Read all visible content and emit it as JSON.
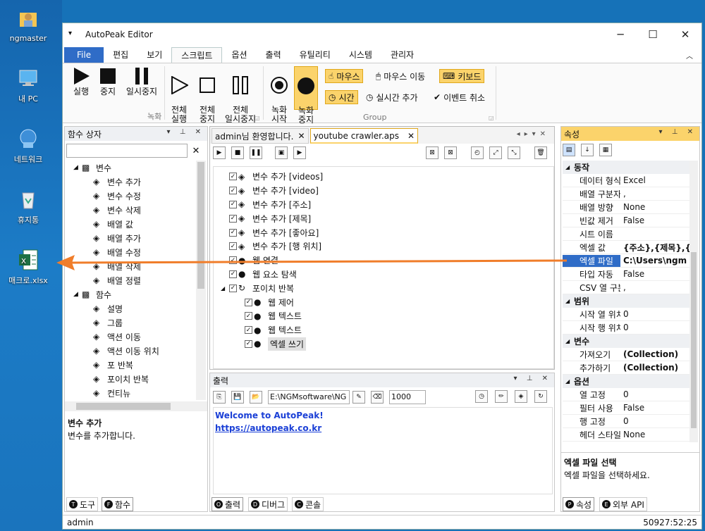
{
  "desktop": {
    "icons": [
      {
        "label": "ngmaster"
      },
      {
        "label": "내 PC"
      },
      {
        "label": "네트워크"
      },
      {
        "label": "휴지통"
      },
      {
        "label": "매크로.xlsx"
      }
    ]
  },
  "window": {
    "title": "AutoPeak Editor"
  },
  "menu": [
    "File",
    "편집",
    "보기",
    "스크립트",
    "옵션",
    "출력",
    "유틸리티",
    "시스템",
    "관리자"
  ],
  "ribbon": {
    "buttons": [
      {
        "label": "실행"
      },
      {
        "label": "중지"
      },
      {
        "label": "일시중지"
      },
      {
        "label": "전체\n실행"
      },
      {
        "label": "전체\n중지"
      },
      {
        "label": "전체\n일시중지"
      },
      {
        "label": "녹화\n시작"
      },
      {
        "label": "녹화\n중지"
      }
    ],
    "group1": "녹화",
    "group2": "Group",
    "chips": {
      "mouse": "마우스",
      "mouse_move": "마우스 이동",
      "keyboard": "키보드",
      "time": "시간",
      "realtime": "실시간 추가",
      "event_cancel": "이벤트 취소"
    }
  },
  "toolbox": {
    "title": "함수 상자",
    "items": [
      {
        "label": "변수",
        "level": 0
      },
      {
        "label": "변수 추가",
        "level": 1
      },
      {
        "label": "변수 수정",
        "level": 1
      },
      {
        "label": "변수 삭제",
        "level": 1
      },
      {
        "label": "배열 값",
        "level": 1
      },
      {
        "label": "배열 추가",
        "level": 1
      },
      {
        "label": "배열 수정",
        "level": 1
      },
      {
        "label": "배열 삭제",
        "level": 1
      },
      {
        "label": "배열 정렬",
        "level": 1
      },
      {
        "label": "함수",
        "level": 0
      },
      {
        "label": "설명",
        "level": 1
      },
      {
        "label": "그룹",
        "level": 1
      },
      {
        "label": "액션 이동",
        "level": 1
      },
      {
        "label": "액션 이동 위치",
        "level": 1
      },
      {
        "label": "포 반복",
        "level": 1
      },
      {
        "label": "포이치 반복",
        "level": 1
      },
      {
        "label": "컨티뉴",
        "level": 1
      }
    ],
    "desc_title": "변수 추가",
    "desc": "변수를 추가합니다.",
    "tabs": [
      {
        "letter": "T",
        "label": "도구"
      },
      {
        "letter": "F",
        "label": "함수"
      }
    ]
  },
  "editor": {
    "tabs": [
      "admin님 환영합니다.",
      "youtube crawler.aps"
    ],
    "rows": [
      {
        "label": "변수 추가 [videos]",
        "level": 0
      },
      {
        "label": "변수 추가 [video]",
        "level": 0
      },
      {
        "label": "변수 추가 [주소]",
        "level": 0
      },
      {
        "label": "변수 추가 [제목]",
        "level": 0
      },
      {
        "label": "변수 추가 [좋아요]",
        "level": 0
      },
      {
        "label": "변수 추가 [행 위치]",
        "level": 0
      },
      {
        "label": "웹 연결",
        "level": 0
      },
      {
        "label": "웹 요소 탐색",
        "level": 0
      },
      {
        "label": "포이치 반복",
        "level": 0
      },
      {
        "label": "웹 제어",
        "level": 1
      },
      {
        "label": "웹 텍스트",
        "level": 1
      },
      {
        "label": "웹 텍스트",
        "level": 1
      },
      {
        "label": "엑셀 쓰기",
        "level": 1
      }
    ]
  },
  "output": {
    "title": "출력",
    "path": "E:\\NGMsoftware\\NG",
    "count": "1000",
    "line1": "Welcome to AutoPeak!",
    "line2": "https://autopeak.co.kr",
    "tabs": [
      {
        "letter": "O",
        "label": "출력"
      },
      {
        "letter": "D",
        "label": "디버그"
      },
      {
        "letter": "C",
        "label": "콘솔"
      }
    ]
  },
  "props": {
    "title": "속성",
    "sections": [
      {
        "name": "동작",
        "rows": [
          [
            "데이터 형식",
            "Excel"
          ],
          [
            "배열 구분자",
            ","
          ],
          [
            "배열 방향",
            "None"
          ],
          [
            "빈값 제거",
            "False"
          ],
          [
            "시트 이름",
            ""
          ],
          [
            "엑셀 값",
            "{주소},{제목},{좋아요}"
          ],
          [
            "엑셀 파일",
            "C:\\Users\\ngm"
          ],
          [
            "타입 자동",
            "False"
          ],
          [
            "CSV 열 구분",
            ","
          ]
        ]
      },
      {
        "name": "범위",
        "rows": [
          [
            "시작 열 위치",
            "0"
          ],
          [
            "시작 행 위치",
            "0"
          ]
        ]
      },
      {
        "name": "변수",
        "rows": [
          [
            "가져오기",
            "(Collection)"
          ],
          [
            "추가하기",
            "(Collection)"
          ]
        ]
      },
      {
        "name": "옵션",
        "rows": [
          [
            "열 고정",
            "0"
          ],
          [
            "필터 사용",
            "False"
          ],
          [
            "행 고정",
            "0"
          ],
          [
            "헤더 스타일",
            "None"
          ]
        ]
      }
    ],
    "desc_title": "엑셀 파일 선택",
    "desc": "엑셀 파일을 선택하세요.",
    "tabs": [
      {
        "letter": "P",
        "label": "속성"
      },
      {
        "letter": "E",
        "label": "외부 API"
      }
    ]
  },
  "status": {
    "user": "admin",
    "right": "50927:52:25"
  },
  "colors": {
    "accent": "#2f6cc7",
    "arrow": "#f07d2a",
    "highlight": "#fbd36b"
  }
}
